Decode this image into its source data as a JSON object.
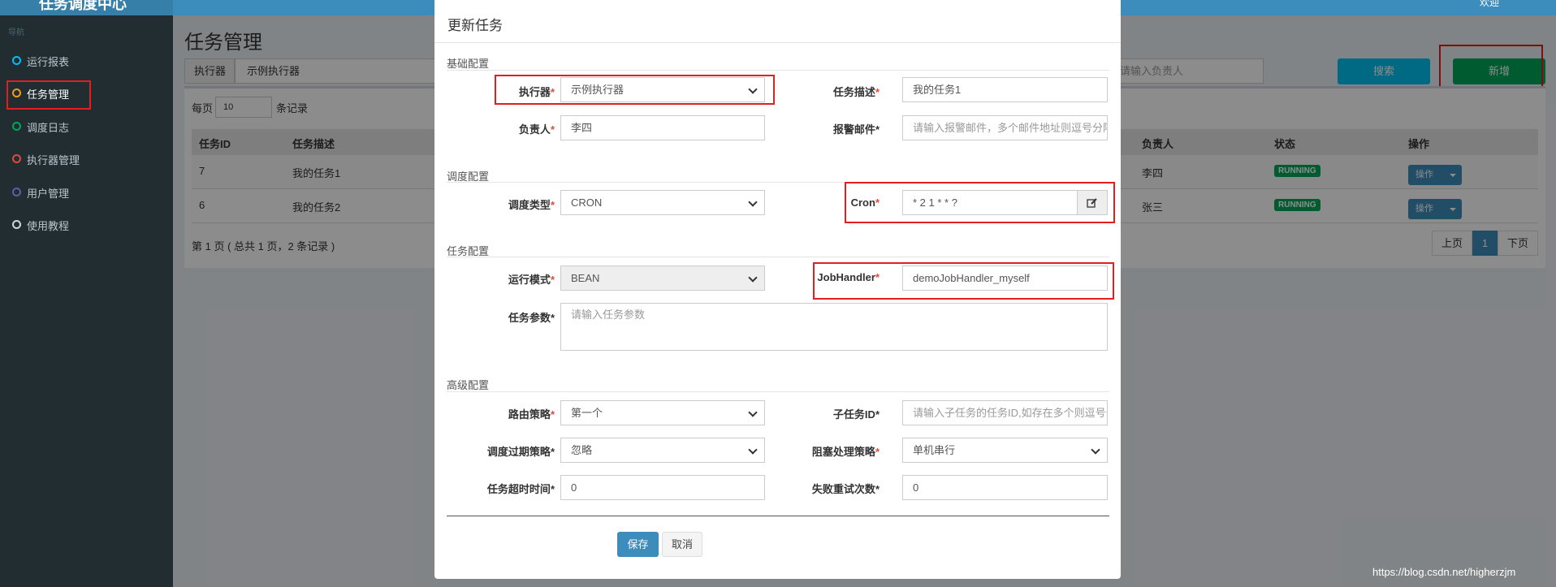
{
  "app": {
    "brand": "任务调度中心",
    "nav_header": "导航"
  },
  "nav": [
    {
      "label": "运行报表",
      "color": "#00c0ef"
    },
    {
      "label": "任务管理",
      "color": "#f39c12"
    },
    {
      "label": "调度日志",
      "color": "#00a65a"
    },
    {
      "label": "执行器管理",
      "color": "#dd4b39"
    },
    {
      "label": "用户管理",
      "color": "#605ca8"
    },
    {
      "label": "使用教程",
      "color": "#d2d6de"
    }
  ],
  "top_right": "欢迎",
  "page": {
    "title": "任务管理",
    "filter_label": "执行器",
    "filter_value": "示例执行器",
    "author_placeholder": "请输入负责人",
    "search_btn": "搜索",
    "add_btn": "新增",
    "per_page_label": "每页",
    "per_page_value": "10",
    "records_label": "条记录",
    "table_headers": [
      "任务ID",
      "任务描述",
      "负责人",
      "状态",
      "操作"
    ],
    "rows": [
      {
        "id": "7",
        "desc": "我的任务1",
        "owner": "李四",
        "status": "RUNNING",
        "op": "操作"
      },
      {
        "id": "6",
        "desc": "我的任务2",
        "owner": "张三",
        "status": "RUNNING",
        "op": "操作"
      }
    ],
    "summary": "第 1 页 ( 总共 1 页，2 条记录 )",
    "pager": {
      "prev": "上页",
      "current": "1",
      "next": "下页"
    }
  },
  "modal": {
    "title": "更新任务",
    "sections": {
      "basic": "基础配置",
      "schedule": "调度配置",
      "task": "任务配置",
      "advanced": "高级配置"
    },
    "fields": {
      "executor": {
        "label": "执行器",
        "value": "示例执行器"
      },
      "job_desc": {
        "label": "任务描述",
        "value": "我的任务1"
      },
      "author": {
        "label": "负责人",
        "value": "李四"
      },
      "alarm_email": {
        "label": "报警邮件",
        "placeholder": "请输入报警邮件，多个邮件地址则逗号分隔"
      },
      "schedule_type": {
        "label": "调度类型",
        "value": "CRON"
      },
      "cron": {
        "label": "Cron",
        "value": "* 2 1 * * ?"
      },
      "glue_type": {
        "label": "运行模式",
        "value": "BEAN"
      },
      "job_handler": {
        "label": "JobHandler",
        "value": "demoJobHandler_myself"
      },
      "job_param": {
        "label": "任务参数",
        "placeholder": "请输入任务参数"
      },
      "route": {
        "label": "路由策略",
        "value": "第一个"
      },
      "child_job": {
        "label": "子任务ID",
        "placeholder": "请输入子任务的任务ID,如存在多个则逗号分隔"
      },
      "misfire": {
        "label": "调度过期策略",
        "value": "忽略"
      },
      "block": {
        "label": "阻塞处理策略",
        "value": "单机串行"
      },
      "timeout": {
        "label": "任务超时时间",
        "value": "0"
      },
      "retry": {
        "label": "失败重试次数",
        "value": "0"
      }
    },
    "save": "保存",
    "cancel": "取消"
  },
  "watermark": "https://blog.csdn.net/higherzjm"
}
